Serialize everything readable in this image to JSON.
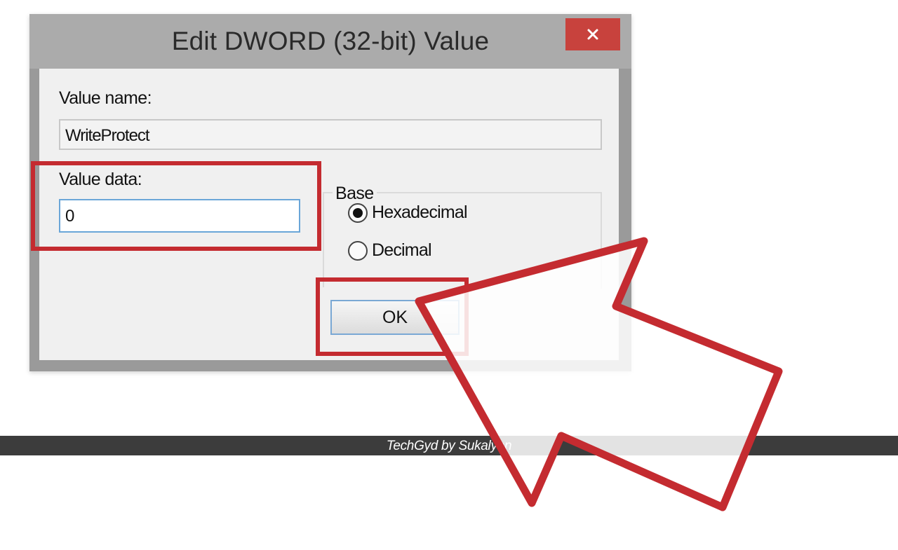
{
  "dialog": {
    "title": "Edit DWORD (32-bit) Value",
    "close_glyph": "×",
    "value_name_label": "Value name:",
    "value_name": "WriteProtect",
    "value_data_label": "Value data:",
    "value_data": "0",
    "base_label": "Base",
    "base_options": [
      {
        "label": "Hexadecimal",
        "selected": true
      },
      {
        "label": "Decimal",
        "selected": false
      }
    ],
    "ok_label": "OK"
  },
  "footer": {
    "watermark": "TechGyd by Sukalyan"
  },
  "colors": {
    "highlight": "#c42b30",
    "close_button": "#c8423d",
    "arrow_fill": "#ffffff"
  },
  "icons": {
    "close": "close-icon",
    "pointer": "pointer-arrow-icon"
  }
}
